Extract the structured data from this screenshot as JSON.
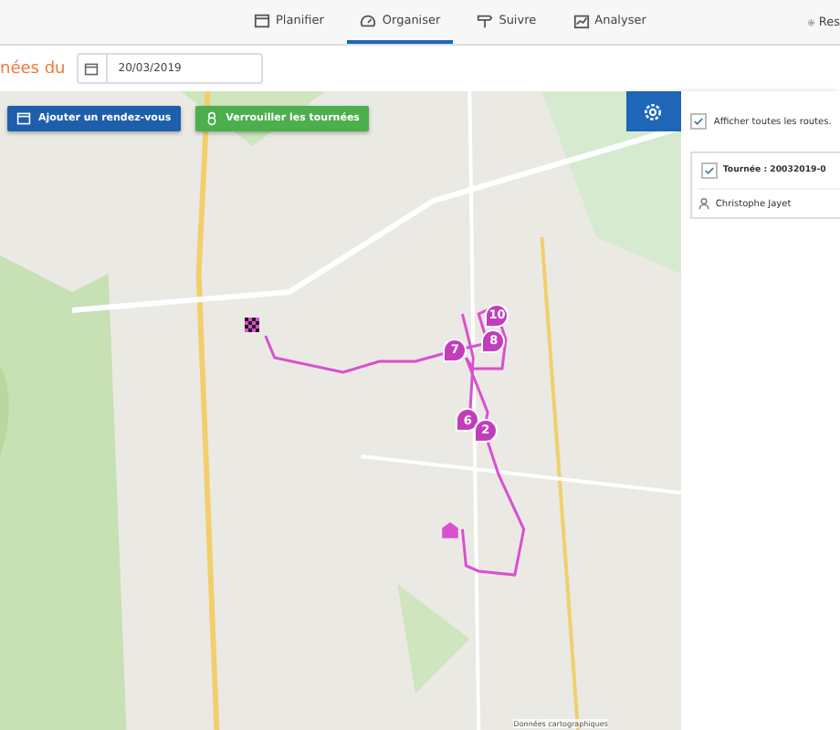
{
  "nav": {
    "tabs": [
      {
        "label": "Planifier",
        "selected": false
      },
      {
        "label": "Organiser",
        "selected": true
      },
      {
        "label": "Suivre",
        "selected": false
      },
      {
        "label": "Analyser",
        "selected": false
      }
    ],
    "right_label": "Res"
  },
  "date_bar": {
    "label": "nées du",
    "date": "20/03/2019"
  },
  "map": {
    "buttons": [
      {
        "label": "Ajouter un rendez-vous",
        "kind": "add"
      },
      {
        "label": "Verrouiller les tournées",
        "kind": "lock"
      }
    ],
    "markers": [
      {
        "label": "10"
      },
      {
        "label": "8"
      },
      {
        "label": "7"
      },
      {
        "label": "6"
      },
      {
        "label": "2"
      }
    ],
    "attribution": "Données cartographiques"
  },
  "panel": {
    "show_all": {
      "label": "Afficher toutes les routes.",
      "checked": true
    },
    "route": {
      "label": "Tournée : 20032019-0",
      "checked": true,
      "driver": "Christophe Jayet"
    }
  }
}
